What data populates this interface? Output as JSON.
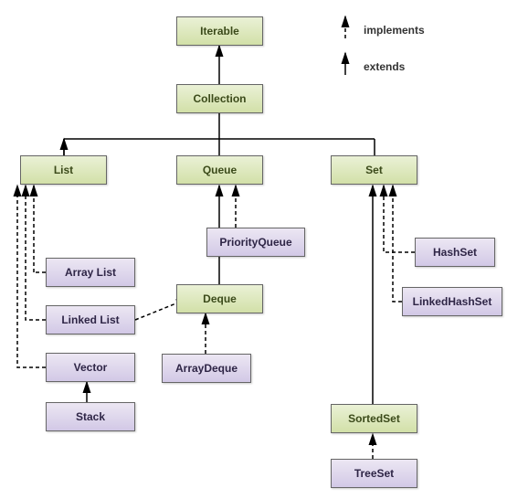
{
  "legend": {
    "implements": "implements",
    "extends": "extends"
  },
  "nodes": {
    "iterable": "Iterable",
    "collection": "Collection",
    "list": "List",
    "queue": "Queue",
    "set": "Set",
    "arraylist": "Array List",
    "linkedlist": "Linked List",
    "vector": "Vector",
    "stack": "Stack",
    "deque": "Deque",
    "priorityqueue": "PriorityQueue",
    "arraydeque": "ArrayDeque",
    "sortedset": "SortedSet",
    "treeset": "TreeSet",
    "hashset": "HashSet",
    "linkedhashset": "LinkedHashSet"
  }
}
